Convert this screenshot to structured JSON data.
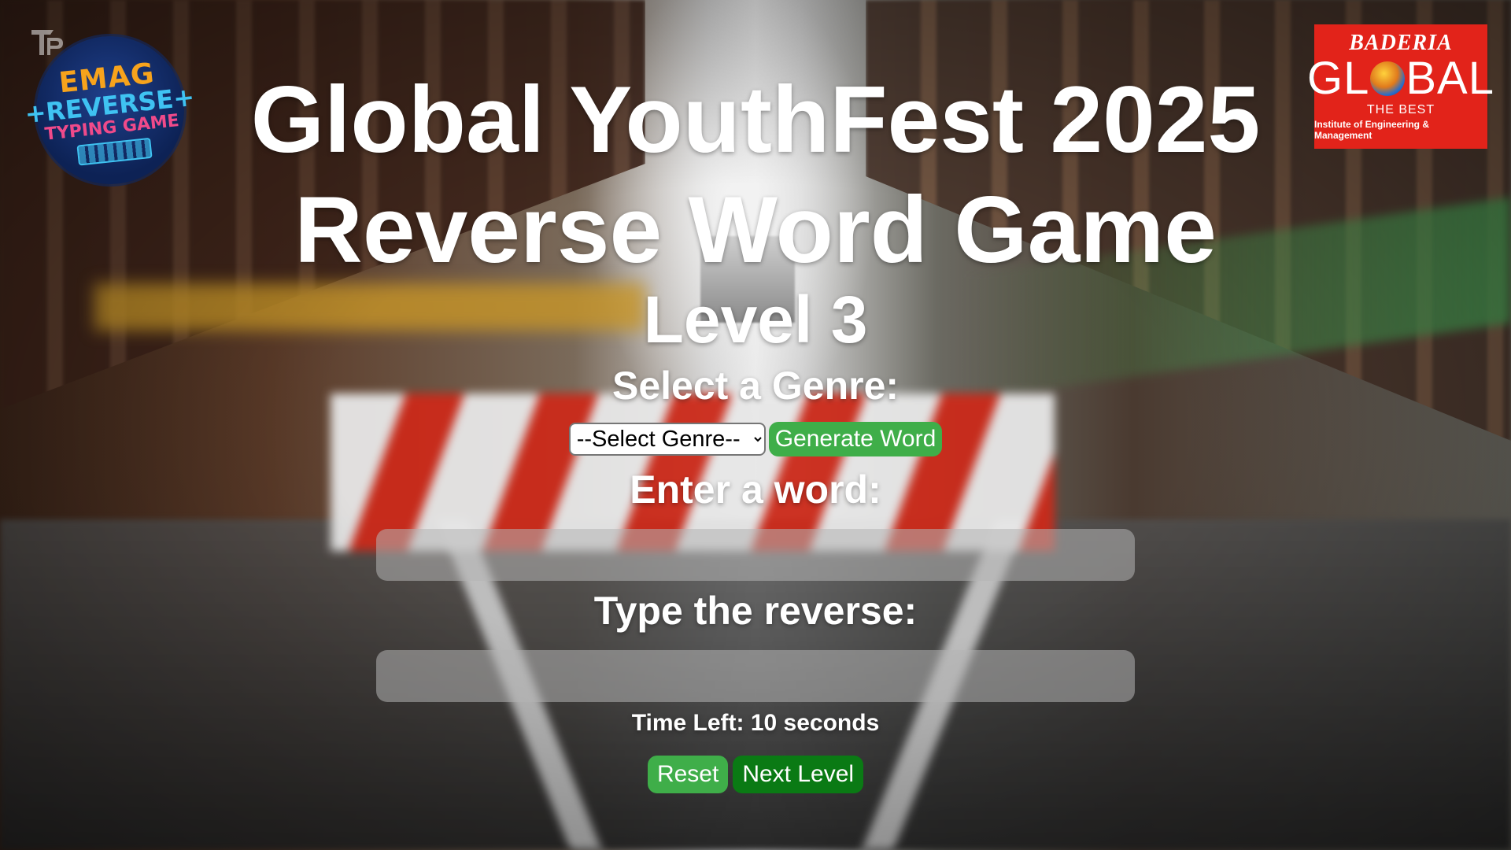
{
  "header": {
    "title_line1": "Global YouthFest 2025",
    "title_line2": "Reverse Word Game",
    "level": "Level 3"
  },
  "logos": {
    "left": {
      "line1": "EMAG",
      "line2": "+REVERSE+",
      "line3": "TYPING GAME"
    },
    "right": {
      "line1": "BADERIA",
      "line2_part1": "GL",
      "line2_part2": "BAL",
      "line3": "THE BEST",
      "line4": "Institute of Engineering & Management",
      "background_color": "#e2231a"
    }
  },
  "genre": {
    "label": "Select a Genre:",
    "selected": "--Select Genre--",
    "generate_label": "Generate Word"
  },
  "word": {
    "label": "Enter a word:",
    "value": ""
  },
  "reverse": {
    "label": "Type the reverse:",
    "value": ""
  },
  "timer": {
    "text": "Time Left: 10 seconds"
  },
  "actions": {
    "reset_label": "Reset",
    "next_label": "Next Level"
  },
  "colors": {
    "button_green": "#3fae49",
    "button_dark_green": "#0a7a14",
    "text": "#ffffff"
  }
}
